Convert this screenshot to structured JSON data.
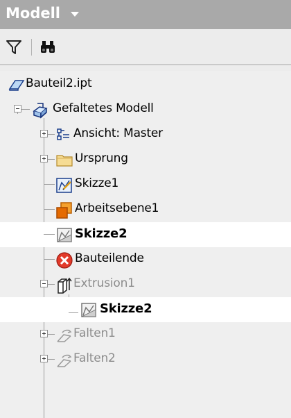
{
  "panel": {
    "title": "Modell"
  },
  "toolbar": {
    "filter_icon": "filter-icon",
    "find_icon": "binoculars-icon"
  },
  "tree": {
    "root": {
      "label": "Bauteil2.ipt",
      "icon": "part-icon"
    },
    "items": [
      {
        "label": "Gefaltetes Modell",
        "icon": "sheet-metal-icon",
        "expander": "minus"
      },
      {
        "label": "Ansicht: Master",
        "icon": "view-icon",
        "expander": "plus"
      },
      {
        "label": "Ursprung",
        "icon": "folder-icon",
        "expander": "plus"
      },
      {
        "label": "Skizze1",
        "icon": "sketch-icon"
      },
      {
        "label": "Arbeitsebene1",
        "icon": "work-plane-icon"
      },
      {
        "label": "Skizze2",
        "icon": "sketch-icon",
        "selected": true,
        "bold": true
      },
      {
        "label": "Bauteilende",
        "icon": "end-of-part-icon"
      },
      {
        "label": "Extrusion1",
        "icon": "extrusion-icon",
        "expander": "minus",
        "dimmed": true
      },
      {
        "label": "Skizze2",
        "icon": "sketch-icon",
        "bold": true,
        "selected": true
      },
      {
        "label": "Falten1",
        "icon": "fold-icon",
        "expander": "plus",
        "dimmed": true
      },
      {
        "label": "Falten2",
        "icon": "fold-icon",
        "expander": "plus",
        "dimmed": true
      }
    ]
  },
  "colors": {
    "header_bg": "#a9a9a9",
    "panel_bg": "#efefef",
    "selected_row_bg": "#ffffff",
    "dimmed_text": "#8c8c8c"
  }
}
